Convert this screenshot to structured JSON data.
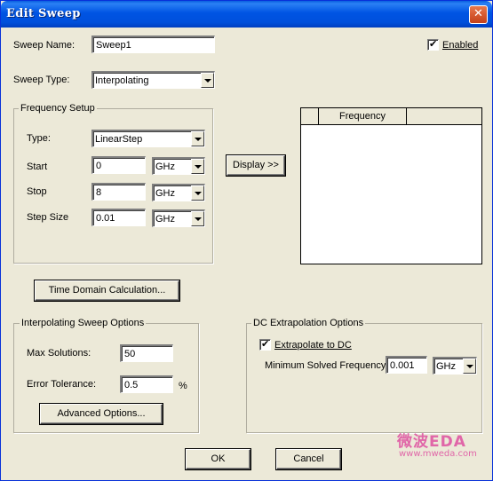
{
  "window": {
    "title": "Edit Sweep",
    "close_glyph": "✕"
  },
  "sweep": {
    "name_label": "Sweep Name:",
    "name_value": "Sweep1",
    "type_label": "Sweep Type:",
    "type_value": "Interpolating",
    "enabled_label": "Enabled",
    "enabled_checked": true
  },
  "frequency_setup": {
    "group_title": "Frequency Setup",
    "type_label": "Type:",
    "type_value": "LinearStep",
    "start_label": "Start",
    "start_value": "0",
    "start_unit": "GHz",
    "stop_label": "Stop",
    "stop_value": "8",
    "stop_unit": "GHz",
    "step_label": "Step Size",
    "step_value": "0.01",
    "step_unit": "GHz"
  },
  "display_button": "Display >>",
  "frequency_table": {
    "columns": [
      "",
      "Frequency",
      ""
    ],
    "rows": []
  },
  "time_domain_button": "Time Domain Calculation...",
  "interp_options": {
    "group_title": "Interpolating Sweep Options",
    "max_solutions_label": "Max Solutions:",
    "max_solutions_value": "50",
    "error_tolerance_label": "Error Tolerance:",
    "error_tolerance_value": "0.5",
    "percent_label": "%",
    "advanced_button": "Advanced Options..."
  },
  "dc_extrapolation": {
    "group_title": "DC Extrapolation Options",
    "extrapolate_label": "Extrapolate to DC",
    "extrapolate_checked": true,
    "min_freq_label": "Minimum Solved Frequency",
    "min_freq_value": "0.001",
    "min_freq_unit": "GHz"
  },
  "footer": {
    "ok_label": "OK",
    "cancel_label": "Cancel"
  },
  "watermark": {
    "logo_text": "微波EDA",
    "url_text": "www.mweda.com"
  }
}
